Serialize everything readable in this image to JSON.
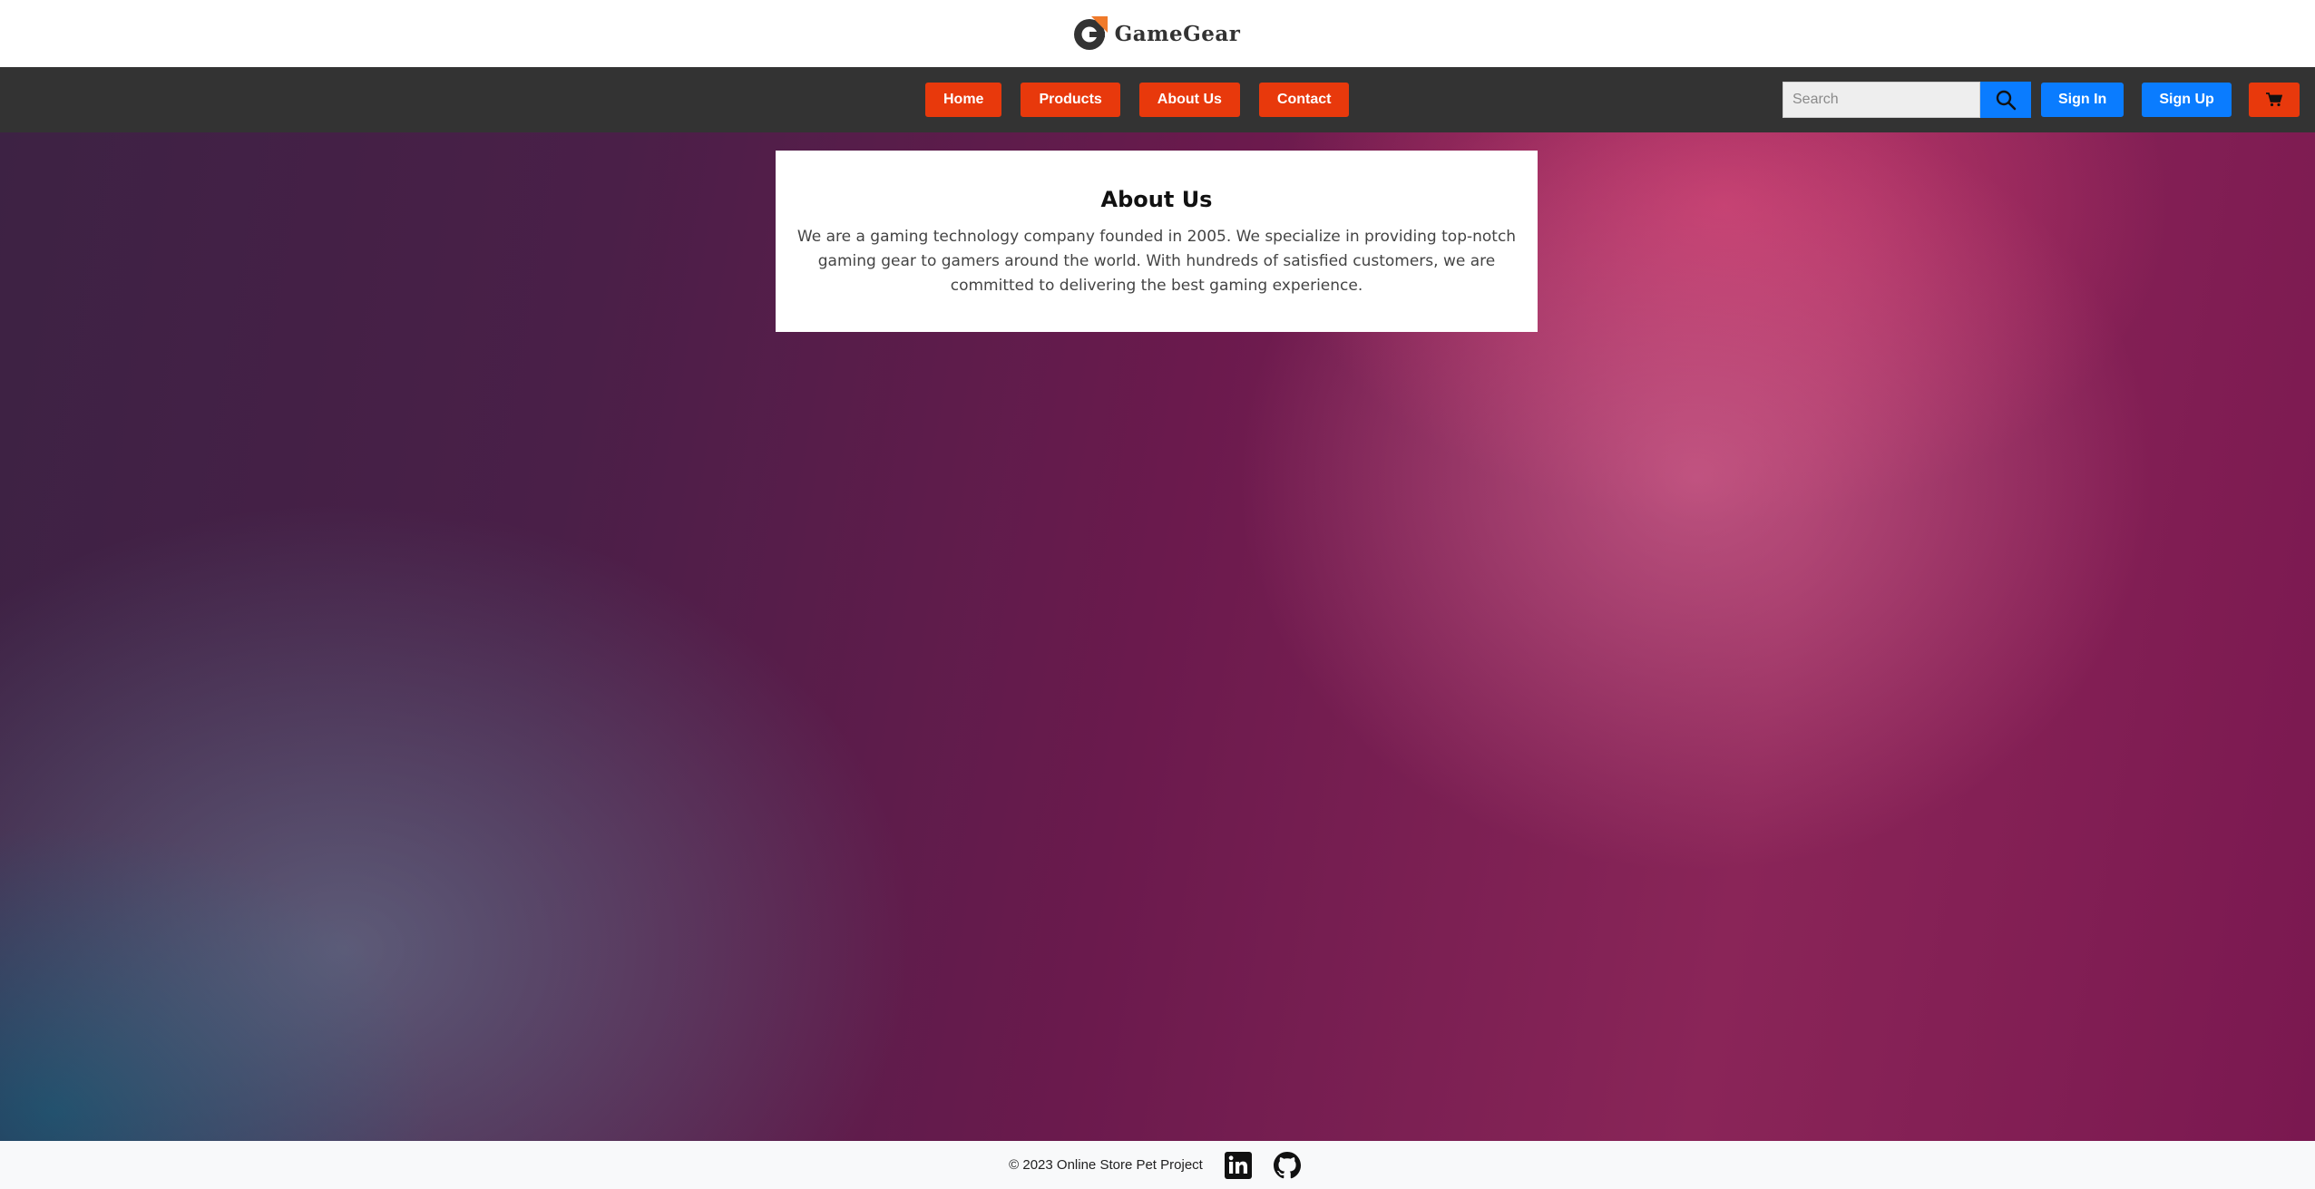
{
  "brand": {
    "name": "GameGear",
    "accent": "#e8390c"
  },
  "nav": {
    "items": [
      {
        "label": "Home"
      },
      {
        "label": "Products"
      },
      {
        "label": "About Us"
      },
      {
        "label": "Contact"
      }
    ]
  },
  "search": {
    "placeholder": "Search",
    "value": "",
    "icon": "search-icon"
  },
  "auth": {
    "sign_in": "Sign In",
    "sign_up": "Sign Up",
    "color": "#0a7cff"
  },
  "cart": {
    "icon": "cart-icon"
  },
  "about": {
    "title": "About Us",
    "body": "We are a gaming technology company founded in 2005. We specialize in providing top-notch gaming gear to gamers around the world. With hundreds of satisfied customers, we are committed to delivering the best gaming experience."
  },
  "footer": {
    "text": "© 2023 Online Store Pet Project",
    "links": [
      {
        "icon": "linkedin-icon"
      },
      {
        "icon": "github-icon"
      }
    ]
  }
}
